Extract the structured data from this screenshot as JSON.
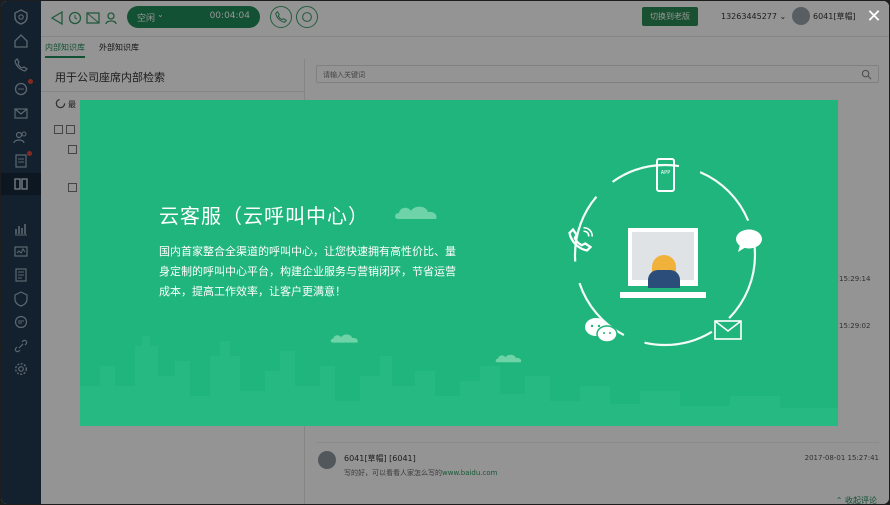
{
  "topbar": {
    "status_label": "空闲",
    "timer": "00:04:04",
    "switch_button": "切换到老版",
    "phone_number": "13263445277",
    "user_name": "6041[草帽]"
  },
  "tabs": {
    "inner": "内部知识库",
    "outer": "外部知识库"
  },
  "left_panel": {
    "title": "用于公司座席内部检索",
    "item_label": "最"
  },
  "right_panel": {
    "search_placeholder": "请输入关键词",
    "timestamp_1": "15:29:14",
    "timestamp_2": "15:29:02",
    "comment": {
      "author": "6041[草帽] [6041]",
      "time": "2017-08-01 15:27:41",
      "text": "写的好，可以看看人家怎么写的",
      "link": "www.baidu.com"
    },
    "collapse_label": "收起评论"
  },
  "modal": {
    "title": "云客服（云呼叫中心）",
    "description": "国内首家整合全渠道的呼叫中心，让您快速拥有高性价比、量身定制的呼叫中心平台，构建企业服务与营销闭环，节省运营成本，提高工作效率，让客户更满意！",
    "app_badge": "APP",
    "close_symbol": "✕"
  },
  "colors": {
    "banner_green": "#1fb57c",
    "sidebar_navy": "#1f3a4f",
    "accent_green": "#1f8c5a"
  }
}
